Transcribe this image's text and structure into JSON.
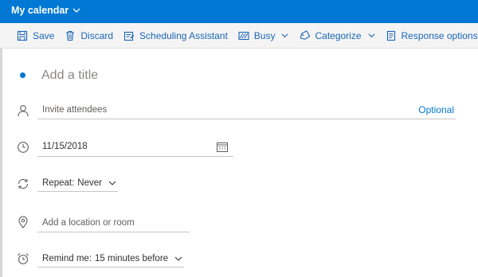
{
  "header": {
    "calendar_name": "My calendar"
  },
  "toolbar": {
    "save": "Save",
    "discard": "Discard",
    "scheduling": "Scheduling Assistant",
    "busy": "Busy",
    "categorize": "Categorize",
    "response": "Response options"
  },
  "form": {
    "title_placeholder": "Add a title",
    "attendees_placeholder": "Invite attendees",
    "optional": "Optional",
    "date": "11/15/2018",
    "repeat_label": "Repeat:",
    "repeat_value": "Never",
    "location_placeholder": "Add a location or room",
    "remind_label": "Remind me:",
    "remind_value": "15 minutes before"
  },
  "colors": {
    "accent": "#0078d4",
    "toolbar_link": "#1a66b8"
  }
}
